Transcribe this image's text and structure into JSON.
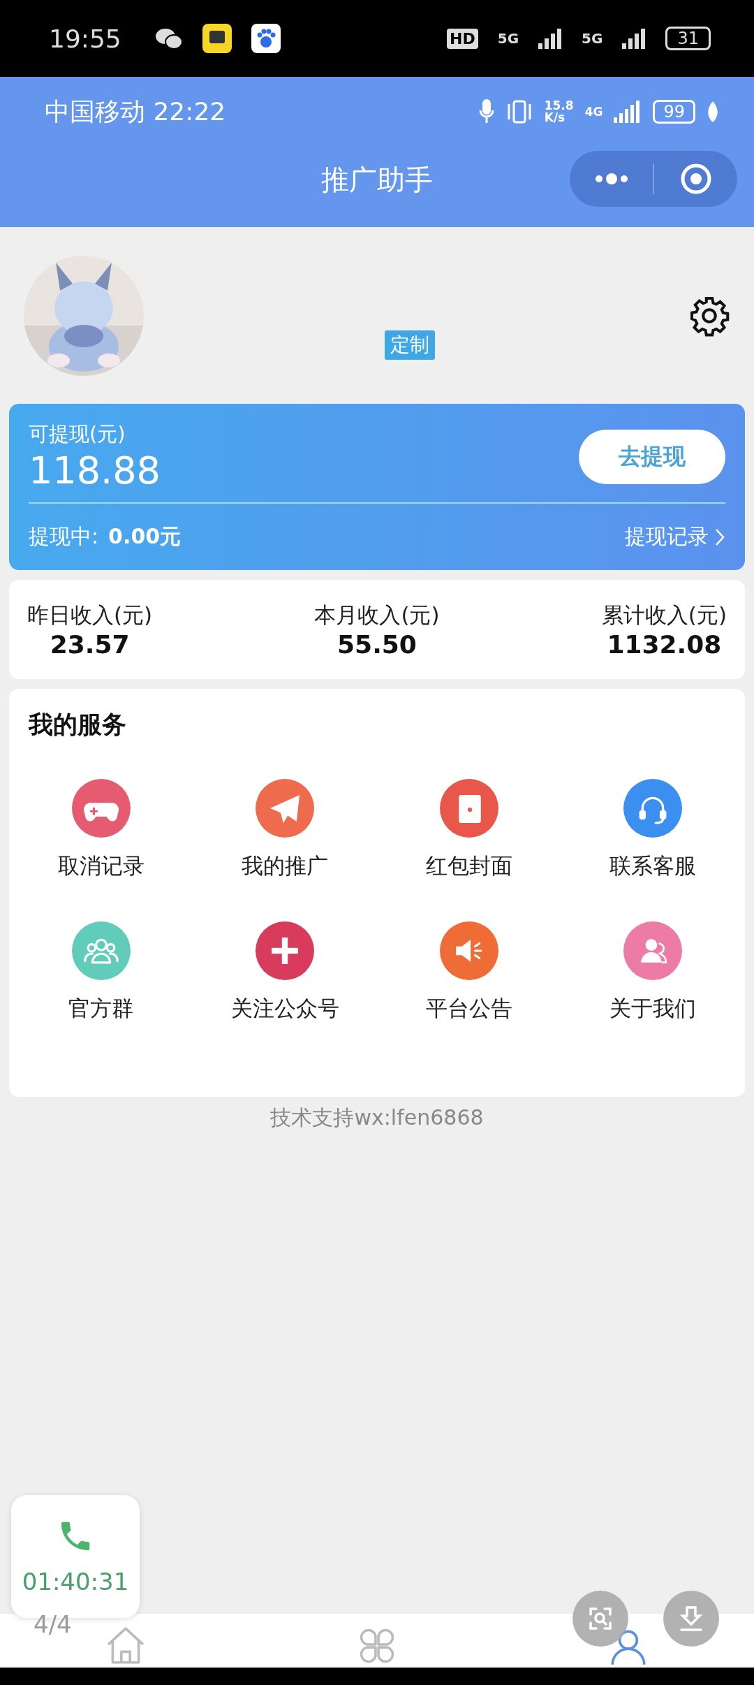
{
  "phone_status_bar": {
    "time": "19:55",
    "hd_label": "HD",
    "network_labels": [
      "5G",
      "5G"
    ],
    "battery": "31"
  },
  "app_status_bar": {
    "carrier_time": "中国移动 22:22",
    "speed_value": "15.8",
    "speed_unit": "K/s",
    "network": "4G",
    "battery": "99"
  },
  "header": {
    "title": "推广助手"
  },
  "profile": {
    "badge": "定制"
  },
  "balance_card": {
    "label": "可提现(元)",
    "amount": "118.88",
    "button": "去提现",
    "pending_label": "提现中:",
    "pending_value": "0.00元",
    "record_link": "提现记录"
  },
  "stats": [
    {
      "label": "昨日收入(元)",
      "value": "23.57"
    },
    {
      "label": "本月收入(元)",
      "value": "55.50"
    },
    {
      "label": "累计收入(元)",
      "value": "1132.08"
    }
  ],
  "services": {
    "title": "我的服务",
    "items": [
      {
        "label": "取消记录",
        "kind": "gamepad",
        "color": "#e65b70"
      },
      {
        "label": "我的推广",
        "kind": "plane",
        "color": "#ee6b4d"
      },
      {
        "label": "红包封面",
        "kind": "envelope",
        "color": "#e9574a"
      },
      {
        "label": "联系客服",
        "kind": "headset",
        "color": "#3a8ff0"
      },
      {
        "label": "官方群",
        "kind": "people",
        "color": "#62ccbb"
      },
      {
        "label": "关注公众号",
        "kind": "plus",
        "color": "#d83b5b"
      },
      {
        "label": "平台公告",
        "kind": "speaker",
        "color": "#ef6c36"
      },
      {
        "label": "关于我们",
        "kind": "person",
        "color": "#ec7ba6"
      }
    ]
  },
  "support_text": "技术支持wx:lfen6868",
  "call_widget": {
    "duration": "01:40:31"
  },
  "page_counter": "4/4",
  "bottom_nav": [
    {
      "kind": "home",
      "selected": false
    },
    {
      "kind": "grid",
      "selected": false
    },
    {
      "kind": "profile",
      "selected": true
    }
  ],
  "floating_buttons": [
    {
      "kind": "scan"
    },
    {
      "kind": "download"
    }
  ]
}
